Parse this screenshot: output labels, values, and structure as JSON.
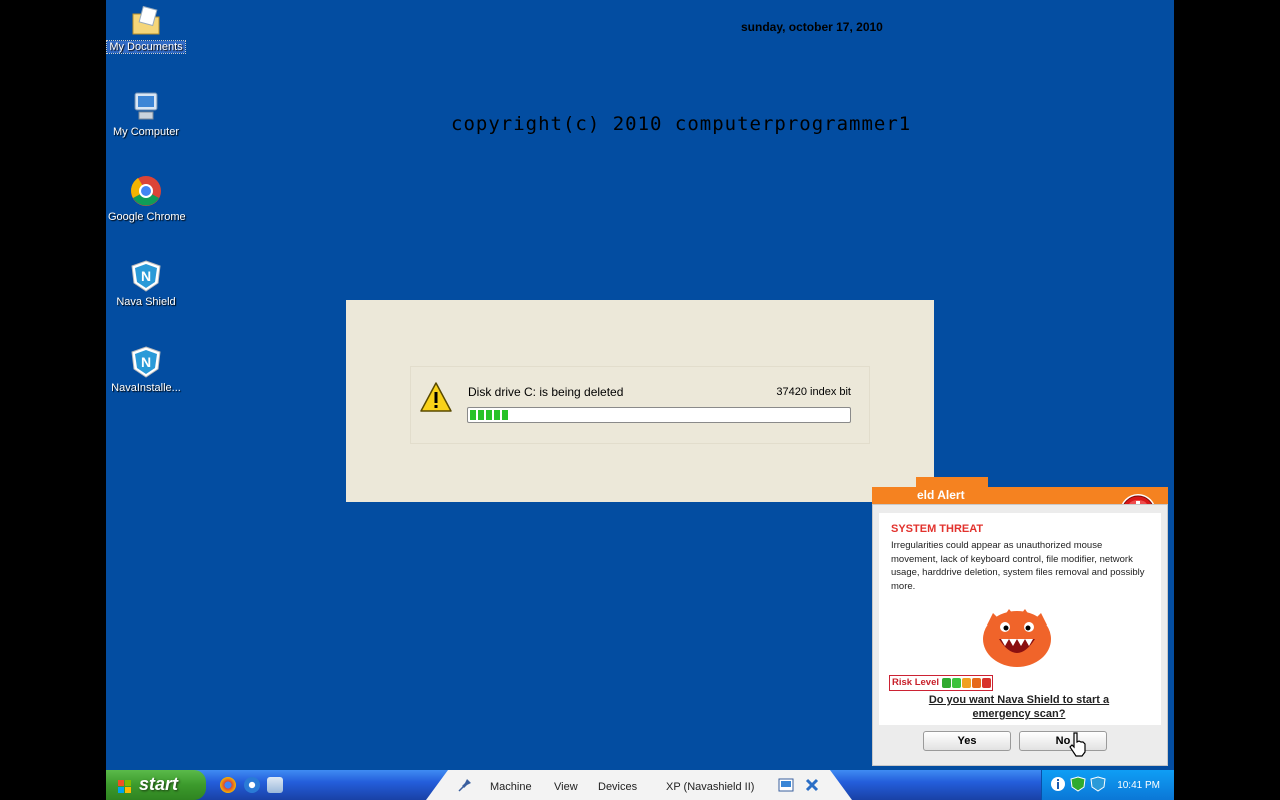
{
  "desktop": {
    "date": "sunday, october 17, 2010",
    "copyright": "copyright(c) 2010 computerprogrammer1",
    "icons": [
      {
        "label": "My Documents",
        "icon": "folder-documents-icon"
      },
      {
        "label": "My Computer",
        "icon": "computer-icon"
      },
      {
        "label": "Google Chrome",
        "icon": "chrome-icon"
      },
      {
        "label": "Nava Shield",
        "icon": "nava-shield-icon"
      },
      {
        "label": "NavaInstalle...",
        "icon": "nava-installer-icon"
      }
    ]
  },
  "dialog": {
    "message": "Disk drive C: is being deleted",
    "bits": "37420 index bit",
    "progress": 0.1
  },
  "alert": {
    "title": "eld Alert",
    "threat": "SYSTEM THREAT",
    "description": "Irregularities could appear as unauthorized mouse movement, lack of keyboard control, file modifier, network usage, harddrive deletion, system files removal and possibly more.",
    "risk_label": "Risk Level",
    "risk_colors": [
      "#2faa2f",
      "#3cc23c",
      "#f0a020",
      "#e66a1a",
      "#d8322a"
    ],
    "question": "Do you want Nava Shield to start a emergency scan?",
    "yes_label": "Yes",
    "no_label": "No"
  },
  "taskbar": {
    "start_label": "start",
    "menu": [
      "Machine",
      "View",
      "Devices"
    ],
    "vm_label": "XP (Navashield II)",
    "clock": "10:41 PM"
  }
}
